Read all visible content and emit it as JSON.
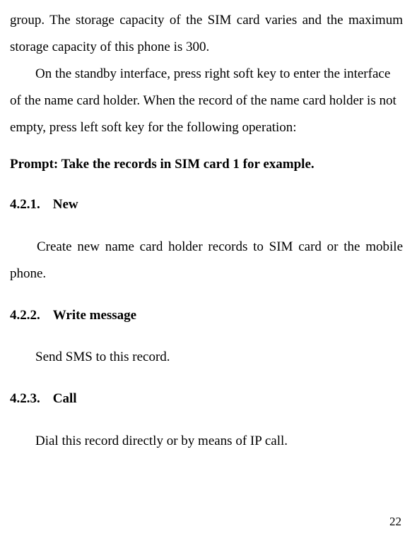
{
  "para1": "group. The storage capacity of the SIM card varies and the maximum storage capacity of this phone is 300.",
  "para2": "On the standby interface, press right soft key to enter the interface of the name card holder. When the record of the name card holder is not empty, press left soft key for the following operation:",
  "prompt": "Prompt: Take the records in SIM card 1 for example.",
  "h421_num": "4.2.1.",
  "h421_title": "New",
  "p421": "Create new name card holder records to SIM card or the mobile phone.",
  "h422_num": "4.2.2.",
  "h422_title": "Write message",
  "p422": "Send SMS to this record.",
  "h423_num": "4.2.3.",
  "h423_title": "Call",
  "p423": "Dial this record directly or by means of IP call.",
  "pageNumber": "22"
}
